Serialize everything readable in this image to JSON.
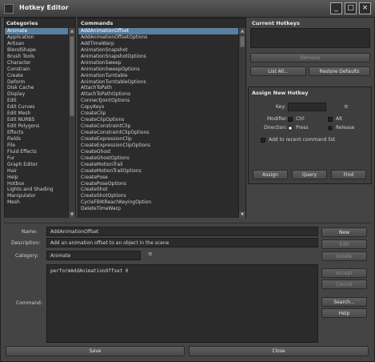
{
  "window": {
    "title": "Hotkey Editor",
    "buttons": [
      "_",
      "□",
      "×"
    ]
  },
  "categories": {
    "header": "Categories",
    "items": [
      "Animate",
      "Application",
      "Artisan",
      "BlendShape",
      "Brush Tools",
      "Character",
      "Constrain",
      "Create",
      "Deform",
      "Disk Cache",
      "Display",
      "Edit",
      "Edit Curves",
      "Edit Mesh",
      "Edit NURBS",
      "Edit Polygons",
      "Effects",
      "Fields",
      "File",
      "Fluid Effects",
      "Fur",
      "Graph Editor",
      "Hair",
      "Help",
      "Hotbox",
      "Lights and Shading",
      "Manipulator",
      "Mesh"
    ],
    "selected": "Animate"
  },
  "commands": {
    "header": "Commands",
    "items": [
      "AddAnimationOffset",
      "AddAnimationOffsetOptions",
      "AddTimeWarp",
      "AnimationSnapshot",
      "AnimationSnapshotOptions",
      "AnimationSweep",
      "AnimationSweepOptions",
      "AnimationTurntable",
      "AnimationTurntableOptions",
      "AttachToPath",
      "AttachToPathOptions",
      "ConnectJointOptions",
      "CopyKeys",
      "CreateClip",
      "CreateClipOptions",
      "CreateConstraintClip",
      "CreateConstraintClipOptions",
      "CreateExpressionClip",
      "CreateExpressionClipOptions",
      "CreateGhost",
      "CreateGhostOptions",
      "CreateMotionTrail",
      "CreateMotionTrailOptions",
      "CreatePose",
      "CreatePoseOptions",
      "CreateShot",
      "CreateShotOptions",
      "CycleFBIKReachKeyingOption",
      "DeleteTimeWarp"
    ],
    "selected": "AddAnimationOffset"
  },
  "current_hotkeys": {
    "header": "Current Hotkeys",
    "remove": "Remove",
    "list_all": "List All...",
    "restore": "Restore Defaults"
  },
  "assign": {
    "header": "Assign New Hotkey",
    "key_label": "Key:",
    "modifier_label": "Modifier:",
    "ctrl": "Ctrl",
    "alt": "Alt",
    "direction_label": "Direction:",
    "press": "Press",
    "release": "Release",
    "recent": "Add to recent command list",
    "assign_btn": "Assign",
    "query_btn": "Query",
    "find_btn": "Find"
  },
  "form": {
    "name_label": "Name:",
    "name_value": "AddAnimationOffset",
    "desc_label": "Description:",
    "desc_value": "Add an animation offset to an object in the scene",
    "category_label": "Category:",
    "category_value": "Animate",
    "command_label": "Command:",
    "command_value": "performAddAnimationOffset 0",
    "new": "New",
    "edit": "Edit",
    "delete": "Delete",
    "accept": "Accept",
    "cancel": "Cancel",
    "search": "Search...",
    "help": "Help"
  },
  "footer": {
    "save": "Save",
    "close": "Close"
  }
}
